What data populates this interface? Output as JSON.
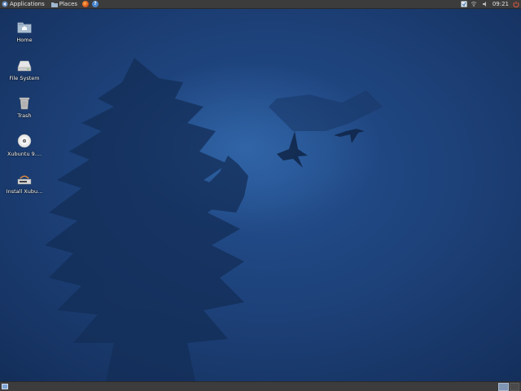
{
  "top_panel": {
    "applications_label": "Applications",
    "places_label": "Places",
    "launchers": [
      "firefox-icon",
      "help-icon"
    ],
    "clock": "09:21"
  },
  "desktop": {
    "icons": [
      {
        "name": "home",
        "label": "Home",
        "icon": "folder-home-icon"
      },
      {
        "name": "file-system",
        "label": "File System",
        "icon": "drive-icon"
      },
      {
        "name": "trash",
        "label": "Trash",
        "icon": "trash-icon"
      },
      {
        "name": "xubuntu-disc",
        "label": "Xubuntu 9....",
        "icon": "cd-icon"
      },
      {
        "name": "install-xubuntu",
        "label": "Install Xubu...",
        "icon": "installer-icon"
      }
    ]
  },
  "colors": {
    "panel": "#3c3c3c",
    "wallpaper": "#1d4179",
    "text": "#ffffff"
  }
}
